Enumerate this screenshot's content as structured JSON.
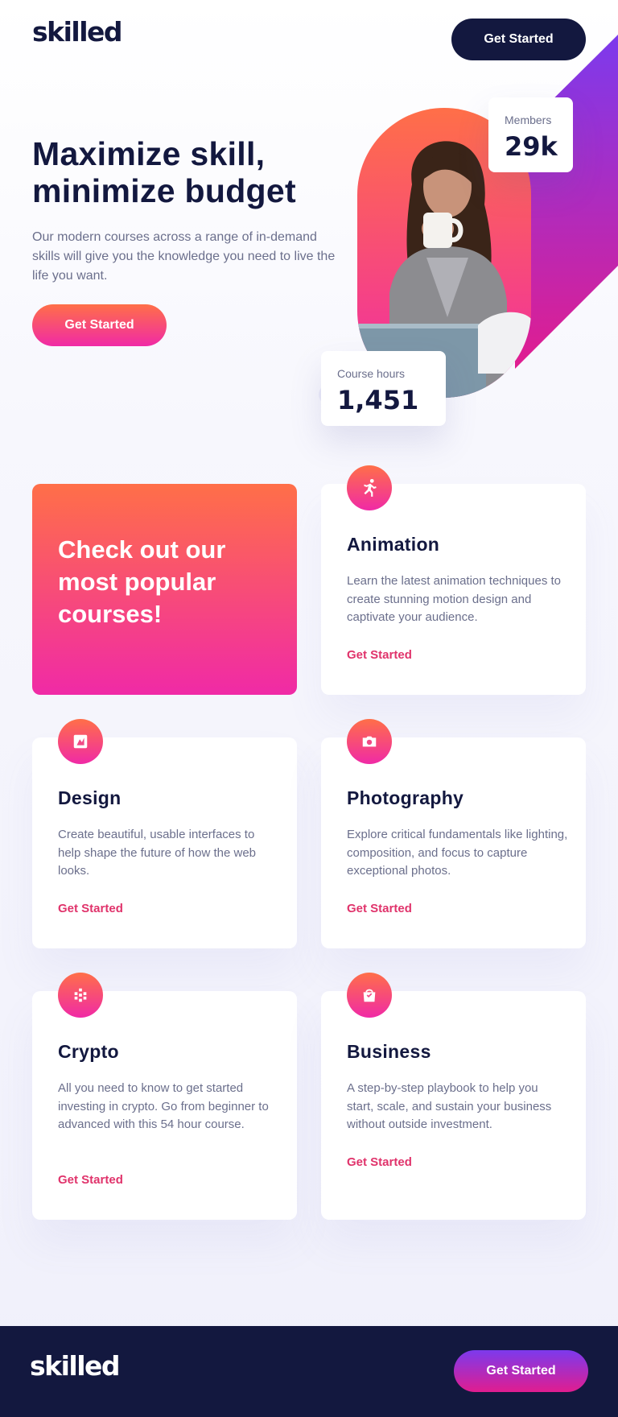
{
  "header": {
    "logo": "skilled",
    "cta_label": "Get Started"
  },
  "hero": {
    "title": "Maximize skill, minimize budget",
    "text": "Our modern courses across a range of in-demand skills will give you the knowledge you need to live the life you want.",
    "cta_label": "Get Started"
  },
  "stats": {
    "members": {
      "label": "Members",
      "value": "29k"
    },
    "hours": {
      "label": "Course hours",
      "value": "1,451"
    }
  },
  "promo": {
    "text": "Check out our most popular courses!"
  },
  "courses": [
    {
      "icon": "running-figure-icon",
      "title": "Animation",
      "desc": "Learn the latest animation techniques to create stunning motion design and captivate your audience.",
      "link": "Get Started"
    },
    {
      "icon": "design-frame-icon",
      "title": "Design",
      "desc": "Create beautiful, usable interfaces to help shape the future of how the web looks.",
      "link": "Get Started"
    },
    {
      "icon": "camera-icon",
      "title": "Photography",
      "desc": "Explore critical fundamentals like lighting, composition, and focus to capture exceptional photos.",
      "link": "Get Started"
    },
    {
      "icon": "crypto-grid-icon",
      "title": "Crypto",
      "desc": "All you need to know to get started investing in crypto. Go from beginner to advanced with this 54 hour course.",
      "link": "Get Started"
    },
    {
      "icon": "shopping-bag-icon",
      "title": "Business",
      "desc": "A step-by-step playbook to help you start, scale, and sustain your business without outside investment.",
      "link": "Get Started"
    }
  ],
  "footer": {
    "logo": "skilled",
    "cta_label": "Get Started"
  },
  "colors": {
    "navy": "#13183f",
    "gradient_start": "#ff6f48",
    "gradient_end": "#f02aa6",
    "link": "#e0336b",
    "purple": "#7c3aed"
  }
}
